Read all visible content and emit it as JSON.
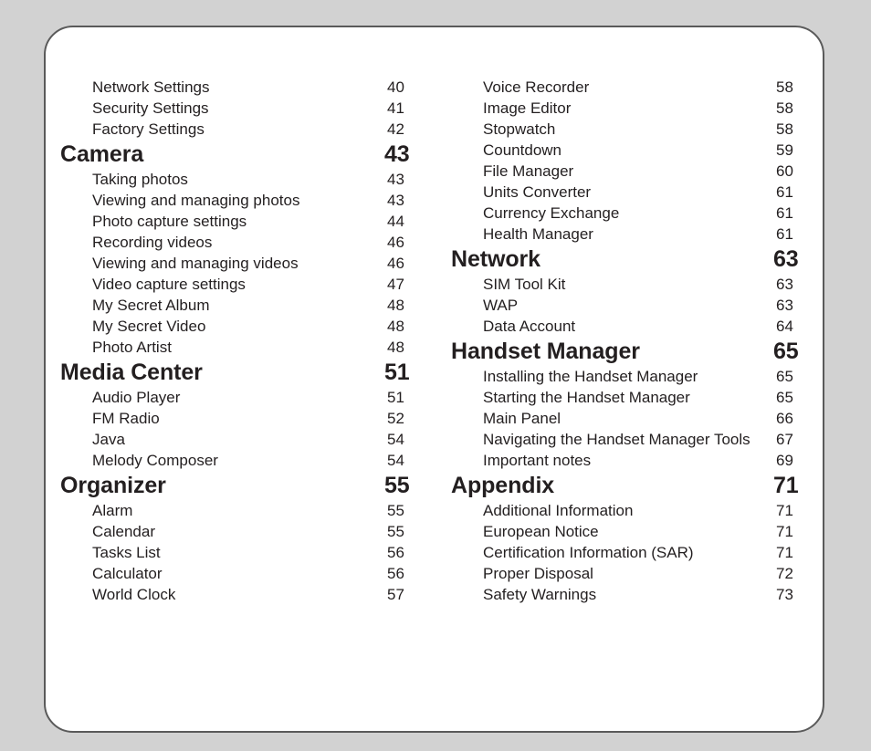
{
  "document": {
    "type": "table-of-contents",
    "background_color": "#d2d2d2",
    "page_color": "#ffffff",
    "border_color": "#5a5a5a",
    "text_color": "#231f20"
  },
  "columns": [
    {
      "name": "left-column",
      "entries": [
        {
          "level": "sub",
          "label": "Network Settings",
          "page": "40"
        },
        {
          "level": "sub",
          "label": "Security Settings",
          "page": "41"
        },
        {
          "level": "sub",
          "label": "Factory Settings",
          "page": "42"
        },
        {
          "level": "heading",
          "label": "Camera",
          "page": "43"
        },
        {
          "level": "sub",
          "label": "Taking photos",
          "page": "43"
        },
        {
          "level": "sub",
          "label": "Viewing and managing photos",
          "page": "43"
        },
        {
          "level": "sub",
          "label": "Photo capture settings",
          "page": "44"
        },
        {
          "level": "sub",
          "label": "Recording videos",
          "page": "46"
        },
        {
          "level": "sub",
          "label": "Viewing and managing videos",
          "page": "46"
        },
        {
          "level": "sub",
          "label": "Video capture settings",
          "page": "47"
        },
        {
          "level": "sub",
          "label": "My Secret Album",
          "page": "48"
        },
        {
          "level": "sub",
          "label": "My Secret Video",
          "page": "48"
        },
        {
          "level": "sub",
          "label": "Photo Artist",
          "page": "48"
        },
        {
          "level": "heading",
          "label": "Media Center",
          "page": "51"
        },
        {
          "level": "sub",
          "label": "Audio Player",
          "page": "51"
        },
        {
          "level": "sub",
          "label": "FM Radio",
          "page": "52"
        },
        {
          "level": "sub",
          "label": "Java",
          "page": "54"
        },
        {
          "level": "sub",
          "label": "Melody Composer",
          "page": "54"
        },
        {
          "level": "heading",
          "label": "Organizer",
          "page": "55"
        },
        {
          "level": "sub",
          "label": "Alarm",
          "page": "55"
        },
        {
          "level": "sub",
          "label": "Calendar",
          "page": "55"
        },
        {
          "level": "sub",
          "label": "Tasks List",
          "page": "56"
        },
        {
          "level": "sub",
          "label": "Calculator",
          "page": "56"
        },
        {
          "level": "sub",
          "label": "World Clock",
          "page": "57"
        }
      ]
    },
    {
      "name": "right-column",
      "entries": [
        {
          "level": "sub",
          "label": "Voice Recorder",
          "page": "58"
        },
        {
          "level": "sub",
          "label": "Image Editor",
          "page": "58"
        },
        {
          "level": "sub",
          "label": "Stopwatch",
          "page": "58"
        },
        {
          "level": "sub",
          "label": "Countdown",
          "page": "59"
        },
        {
          "level": "sub",
          "label": "File Manager",
          "page": "60"
        },
        {
          "level": "sub",
          "label": "Units Converter",
          "page": "61"
        },
        {
          "level": "sub",
          "label": "Currency Exchange",
          "page": "61"
        },
        {
          "level": "sub",
          "label": "Health Manager",
          "page": "61"
        },
        {
          "level": "heading",
          "label": "Network",
          "page": "63"
        },
        {
          "level": "sub",
          "label": "SIM Tool Kit",
          "page": "63"
        },
        {
          "level": "sub",
          "label": "WAP",
          "page": "63"
        },
        {
          "level": "sub",
          "label": "Data Account",
          "page": "64"
        },
        {
          "level": "heading",
          "label": "Handset Manager",
          "page": "65"
        },
        {
          "level": "sub",
          "label": "Installing the Handset Manager",
          "page": "65"
        },
        {
          "level": "sub",
          "label": "Starting the Handset Manager",
          "page": "65"
        },
        {
          "level": "sub",
          "label": "Main Panel",
          "page": "66"
        },
        {
          "level": "sub",
          "label": "Navigating the Handset Manager Tools",
          "page": "67"
        },
        {
          "level": "sub",
          "label": "Important notes",
          "page": "69"
        },
        {
          "level": "heading",
          "label": "Appendix",
          "page": "71"
        },
        {
          "level": "sub",
          "label": "Additional Information",
          "page": "71"
        },
        {
          "level": "sub",
          "label": "European Notice",
          "page": "71"
        },
        {
          "level": "sub",
          "label": "Certification Information (SAR)",
          "page": "71"
        },
        {
          "level": "sub",
          "label": "Proper Disposal",
          "page": "72"
        },
        {
          "level": "sub",
          "label": "Safety Warnings",
          "page": "73"
        }
      ]
    }
  ]
}
